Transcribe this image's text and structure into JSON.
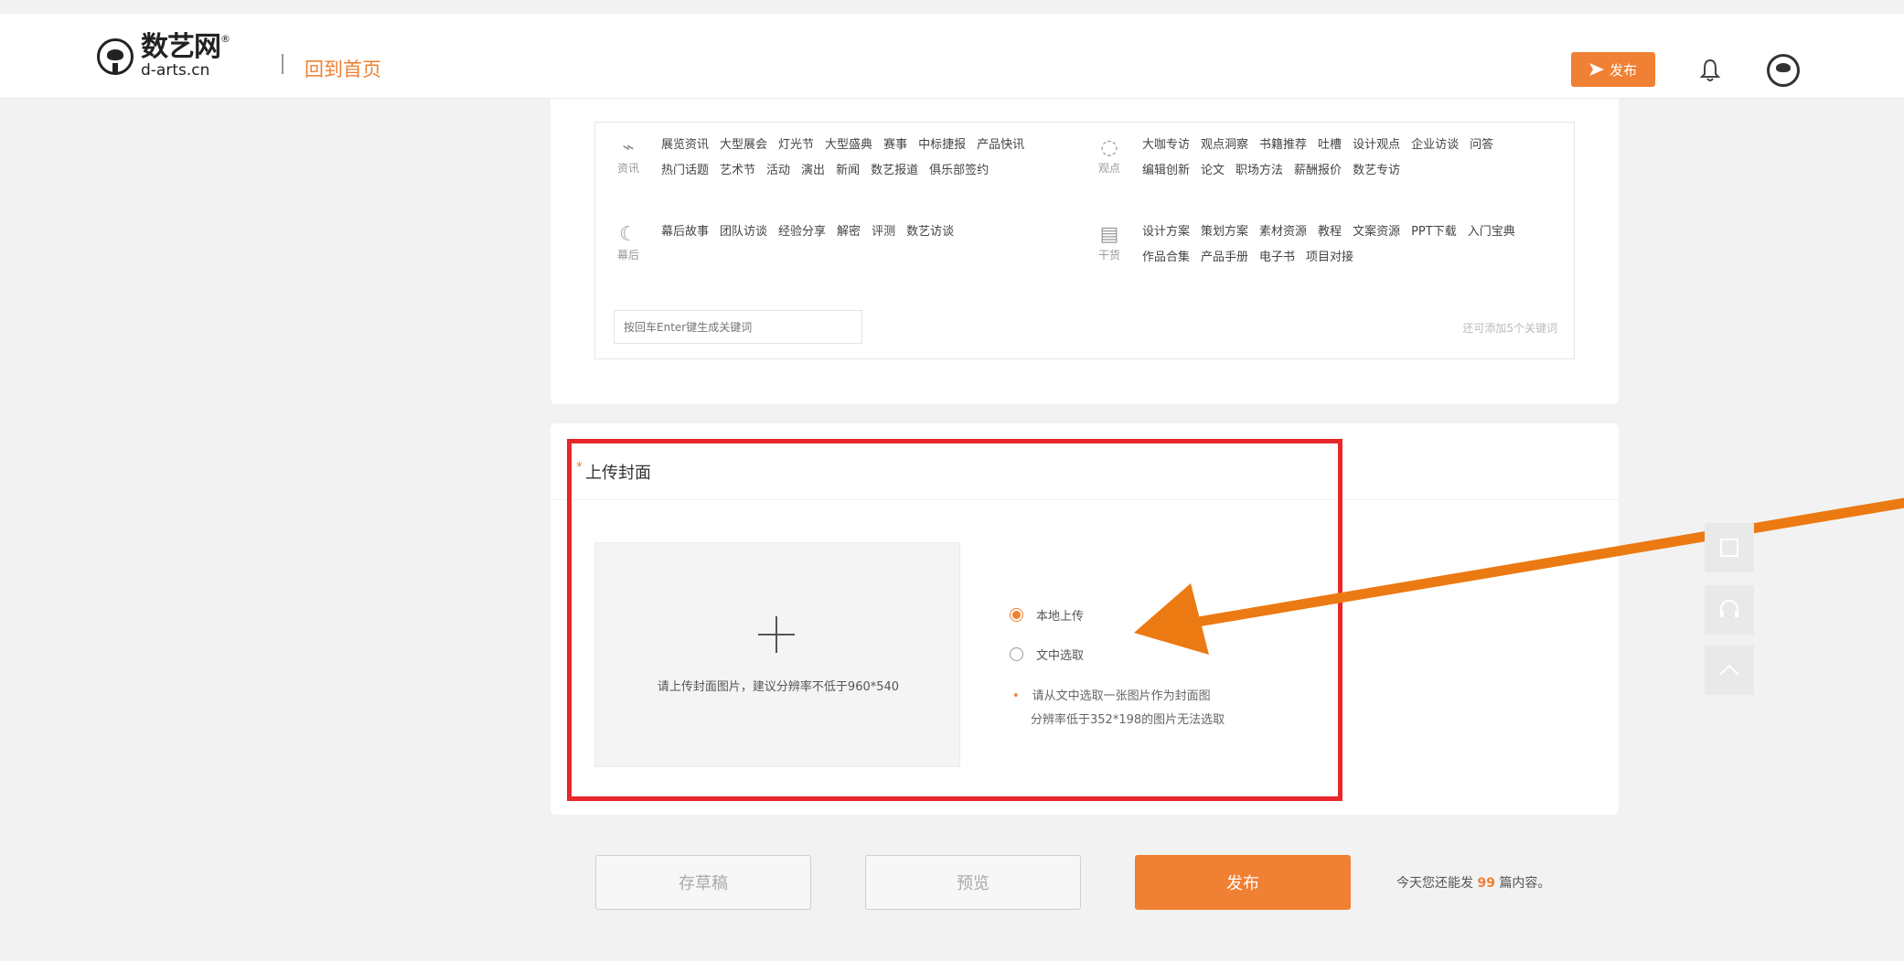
{
  "header": {
    "logo_cn": "数艺网",
    "logo_reg": "®",
    "logo_en": "d-arts.cn",
    "home_link": "回到首页",
    "publish_button": "发布",
    "accent_color": "#f08033"
  },
  "keywords": {
    "groups": [
      {
        "icon": "rss-icon",
        "label": "资讯",
        "tags": [
          "展览资讯",
          "大型展会",
          "灯光节",
          "大型盛典",
          "赛事",
          "中标捷报",
          "产品快讯",
          "热门话题",
          "艺术节",
          "活动",
          "演出",
          "新闻",
          "数艺报道",
          "俱乐部签约"
        ]
      },
      {
        "icon": "location-icon",
        "label": "观点",
        "tags": [
          "大咖专访",
          "观点洞察",
          "书籍推荐",
          "吐槽",
          "设计观点",
          "企业访谈",
          "问答",
          "编辑创新",
          "论文",
          "职场方法",
          "薪酬报价",
          "数艺专访"
        ]
      },
      {
        "icon": "moon-icon",
        "label": "幕后",
        "tags": [
          "幕后故事",
          "团队访谈",
          "经验分享",
          "解密",
          "评测",
          "数艺访谈"
        ]
      },
      {
        "icon": "download-doc-icon",
        "label": "干货",
        "tags": [
          "设计方案",
          "策划方案",
          "素材资源",
          "教程",
          "文案资源",
          "PPT下载",
          "入门宝典",
          "作品合集",
          "产品手册",
          "电子书",
          "项目对接"
        ]
      }
    ],
    "input_placeholder": "按回车Enter键生成关键词",
    "remaining_hint": "还可添加5个关键词"
  },
  "cover": {
    "required_mark": "*",
    "title": "上传封面",
    "upload_hint": "请上传封面图片，建议分辨率不低于960*540",
    "options": [
      {
        "label": "本地上传",
        "checked": true
      },
      {
        "label": "文中选取",
        "checked": false
      }
    ],
    "note_line1": "请从文中选取一张图片作为封面图",
    "note_line2": "分辨率低于352*198的图片无法选取"
  },
  "footer": {
    "draft_button": "存草稿",
    "preview_button": "预览",
    "submit_button": "发布",
    "quota_prefix": "今天您还能发",
    "quota_count": "99",
    "quota_suffix": "篇内容。"
  },
  "annotation": {
    "highlight_color": "#e8272b",
    "arrow_color": "#ec7a12"
  }
}
